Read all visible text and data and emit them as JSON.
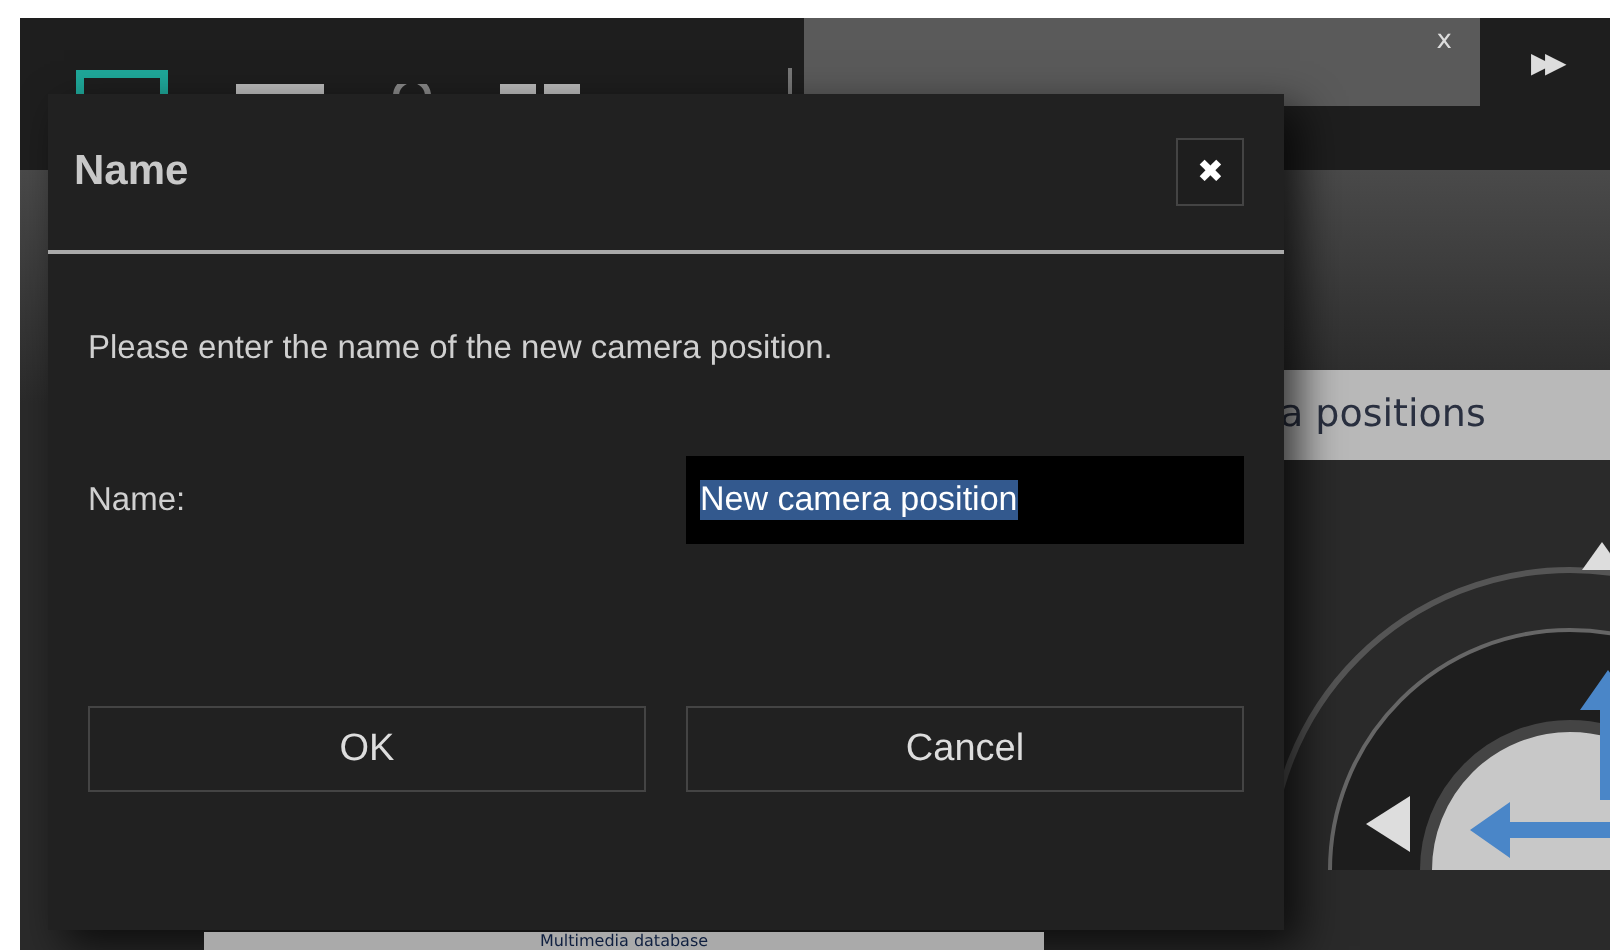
{
  "background": {
    "tab_close": "x",
    "forward_button": "▶▶",
    "banner": "a positions",
    "list_item": "Multimedia database"
  },
  "dialog": {
    "title": "Name",
    "close": "✖",
    "message": "Please enter the name of the new camera position.",
    "field": {
      "label": "Name:",
      "value": "New camera position",
      "text_selected": true
    },
    "buttons": [
      "OK",
      "Cancel"
    ]
  }
}
